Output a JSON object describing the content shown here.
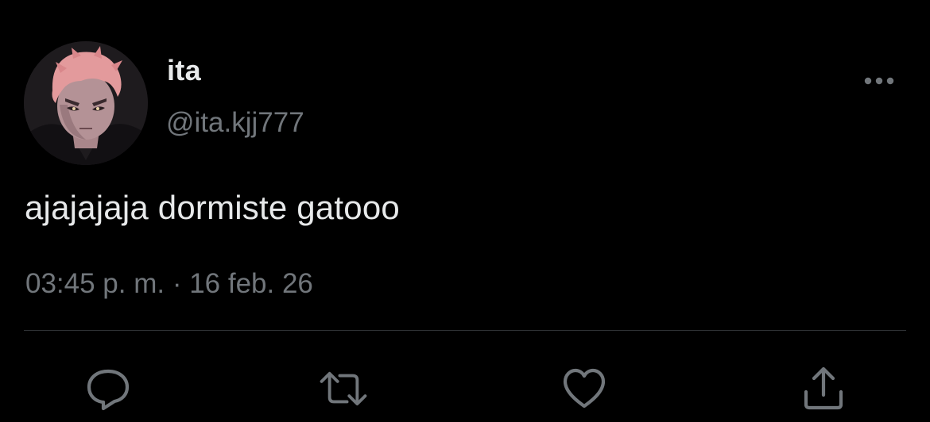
{
  "author": {
    "display_name": "ita",
    "handle": "@ita.kjj777",
    "avatar_icon": "anime-avatar"
  },
  "tweet": {
    "text": "ajajajaja dormiste gatooo",
    "timestamp": "03:45 p. m. · 16 feb. 26"
  },
  "actions": {
    "more_icon": "ellipsis-icon",
    "reply_icon": "reply-icon",
    "retweet_icon": "retweet-icon",
    "like_icon": "heart-icon",
    "share_icon": "share-icon"
  },
  "colors": {
    "background": "#000000",
    "primary_text": "#e7e9ea",
    "secondary_text": "#71767b",
    "divider": "#2f3336"
  }
}
